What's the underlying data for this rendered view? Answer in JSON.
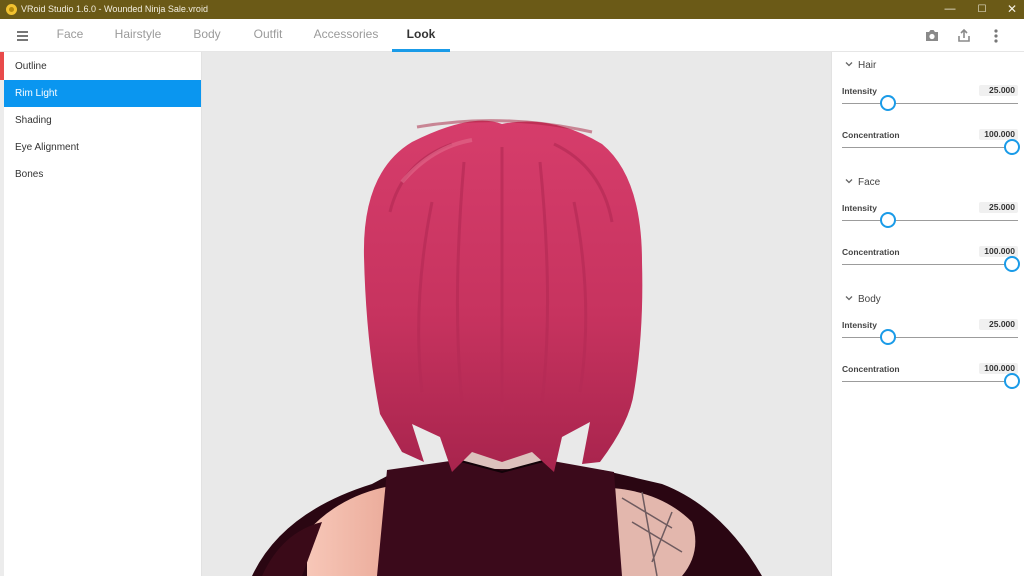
{
  "window": {
    "title": "VRoid Studio 1.6.0 - Wounded Ninja Sale.vroid",
    "minimize_glyph": "—",
    "maximize_glyph": "☐",
    "close_glyph": "✕"
  },
  "tabs": [
    {
      "label": "Face",
      "active": false
    },
    {
      "label": "Hairstyle",
      "active": false
    },
    {
      "label": "Body",
      "active": false
    },
    {
      "label": "Outfit",
      "active": false
    },
    {
      "label": "Accessories",
      "active": false
    },
    {
      "label": "Look",
      "active": true
    }
  ],
  "toolbar_icons": [
    "camera-icon",
    "export-icon",
    "more-vertical-icon"
  ],
  "left_menu": [
    {
      "label": "Outline",
      "selected": false
    },
    {
      "label": "Rim Light",
      "selected": true
    },
    {
      "label": "Shading",
      "selected": false
    },
    {
      "label": "Eye Alignment",
      "selected": false
    },
    {
      "label": "Bones",
      "selected": false
    }
  ],
  "sections": [
    {
      "title": "Hair",
      "params": [
        {
          "label": "Intensity",
          "value": "25.000",
          "fraction": 0.25
        },
        {
          "label": "Concentration",
          "value": "100.000",
          "fraction": 1.0
        }
      ]
    },
    {
      "title": "Face",
      "params": [
        {
          "label": "Intensity",
          "value": "25.000",
          "fraction": 0.25
        },
        {
          "label": "Concentration",
          "value": "100.000",
          "fraction": 1.0
        }
      ]
    },
    {
      "title": "Body",
      "params": [
        {
          "label": "Intensity",
          "value": "25.000",
          "fraction": 0.25
        },
        {
          "label": "Concentration",
          "value": "100.000",
          "fraction": 1.0
        }
      ]
    }
  ],
  "colors": {
    "titlebar": "#6b5a17",
    "accent": "#1a9be8",
    "selected_item": "#0a96f0",
    "hair": "#c7335f",
    "outfit": "#2a0612",
    "skin": "#f1b6a6"
  }
}
